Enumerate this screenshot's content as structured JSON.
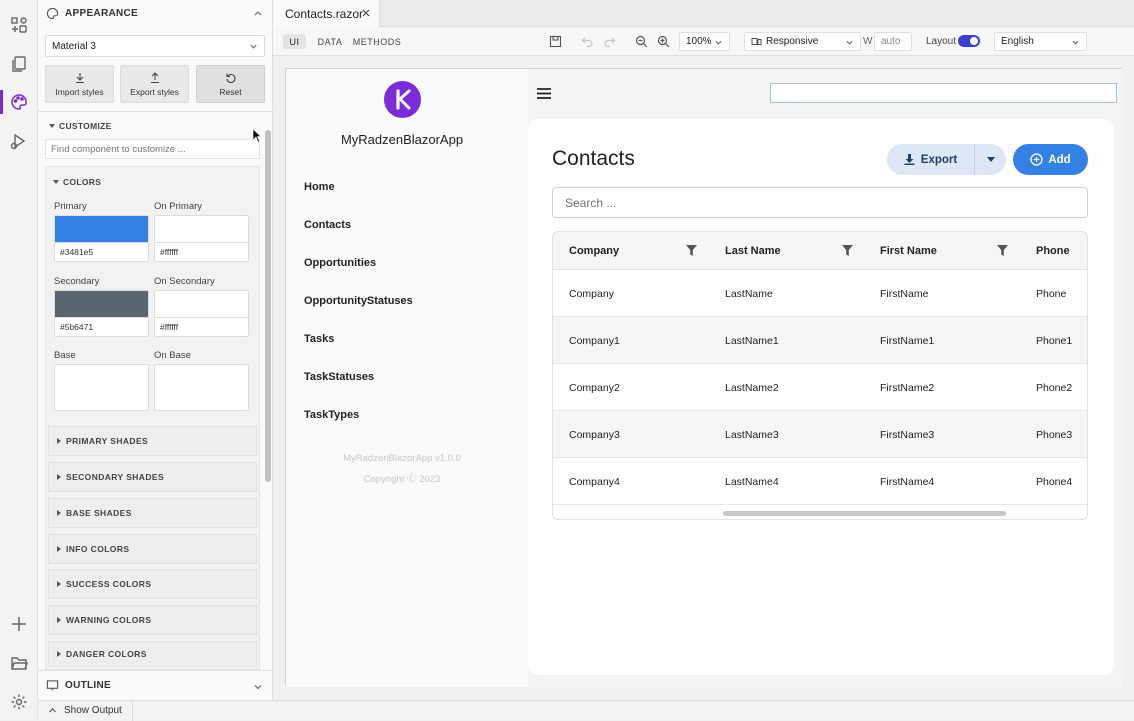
{
  "activity_bar": {
    "items": [
      "components-icon",
      "pages-icon",
      "appearance-icon",
      "run-icon"
    ],
    "bottom": [
      "add-icon",
      "folder-icon",
      "settings-icon"
    ]
  },
  "left_panel": {
    "appearance_title": "APPEARANCE",
    "theme_select": "Material 3",
    "buttons": {
      "import": "Import styles",
      "export": "Export styles",
      "reset": "Reset"
    },
    "customize_title": "CUSTOMIZE",
    "find_placeholder": "Find component to customize ...",
    "colors_title": "COLORS",
    "colors": {
      "primary_label": "Primary",
      "primary_hex": "#3481e5",
      "on_primary_label": "On Primary",
      "on_primary_hex": "#ffffff",
      "secondary_label": "Secondary",
      "secondary_hex": "#5b6471",
      "on_secondary_label": "On Secondary",
      "on_secondary_hex": "#ffffff",
      "base_label": "Base",
      "on_base_label": "On Base"
    },
    "shade_sections": [
      "PRIMARY SHADES",
      "SECONDARY SHADES",
      "BASE SHADES",
      "INFO COLORS",
      "SUCCESS COLORS",
      "WARNING COLORS",
      "DANGER COLORS"
    ],
    "outline_title": "OUTLINE"
  },
  "bottom_bar": {
    "show_output": "Show Output"
  },
  "editor_tab": {
    "label": "Contacts.razor"
  },
  "toolbar": {
    "modes": [
      "UI",
      "DATA",
      "METHODS"
    ],
    "zoom": "100%",
    "device": "Responsive",
    "width_label": "W",
    "width_value": "auto",
    "layout_label": "Layout",
    "language": "English"
  },
  "app": {
    "name": "MyRadzenBlazorApp",
    "nav": [
      "Home",
      "Contacts",
      "Opportunities",
      "OpportunityStatuses",
      "Tasks",
      "TaskStatuses",
      "TaskTypes"
    ],
    "version": "MyRadzenBlazorApp v1.0.0",
    "copyright": "Copyright Ⓒ 2023",
    "page_title": "Contacts",
    "export_label": "Export",
    "add_label": "Add",
    "search_placeholder": "Search ...",
    "columns": [
      "Company",
      "Last Name",
      "First Name",
      "Phone"
    ],
    "rows": [
      [
        "Company",
        "LastName",
        "FirstName",
        "Phone"
      ],
      [
        "Company1",
        "LastName1",
        "FirstName1",
        "Phone1"
      ],
      [
        "Company2",
        "LastName2",
        "FirstName2",
        "Phone2"
      ],
      [
        "Company3",
        "LastName3",
        "FirstName3",
        "Phone3"
      ],
      [
        "Company4",
        "LastName4",
        "FirstName4",
        "Phone4"
      ]
    ]
  },
  "colors": {
    "accent": "#7b2cd9",
    "primary": "#3481e5",
    "secondary": "#5b6471"
  }
}
